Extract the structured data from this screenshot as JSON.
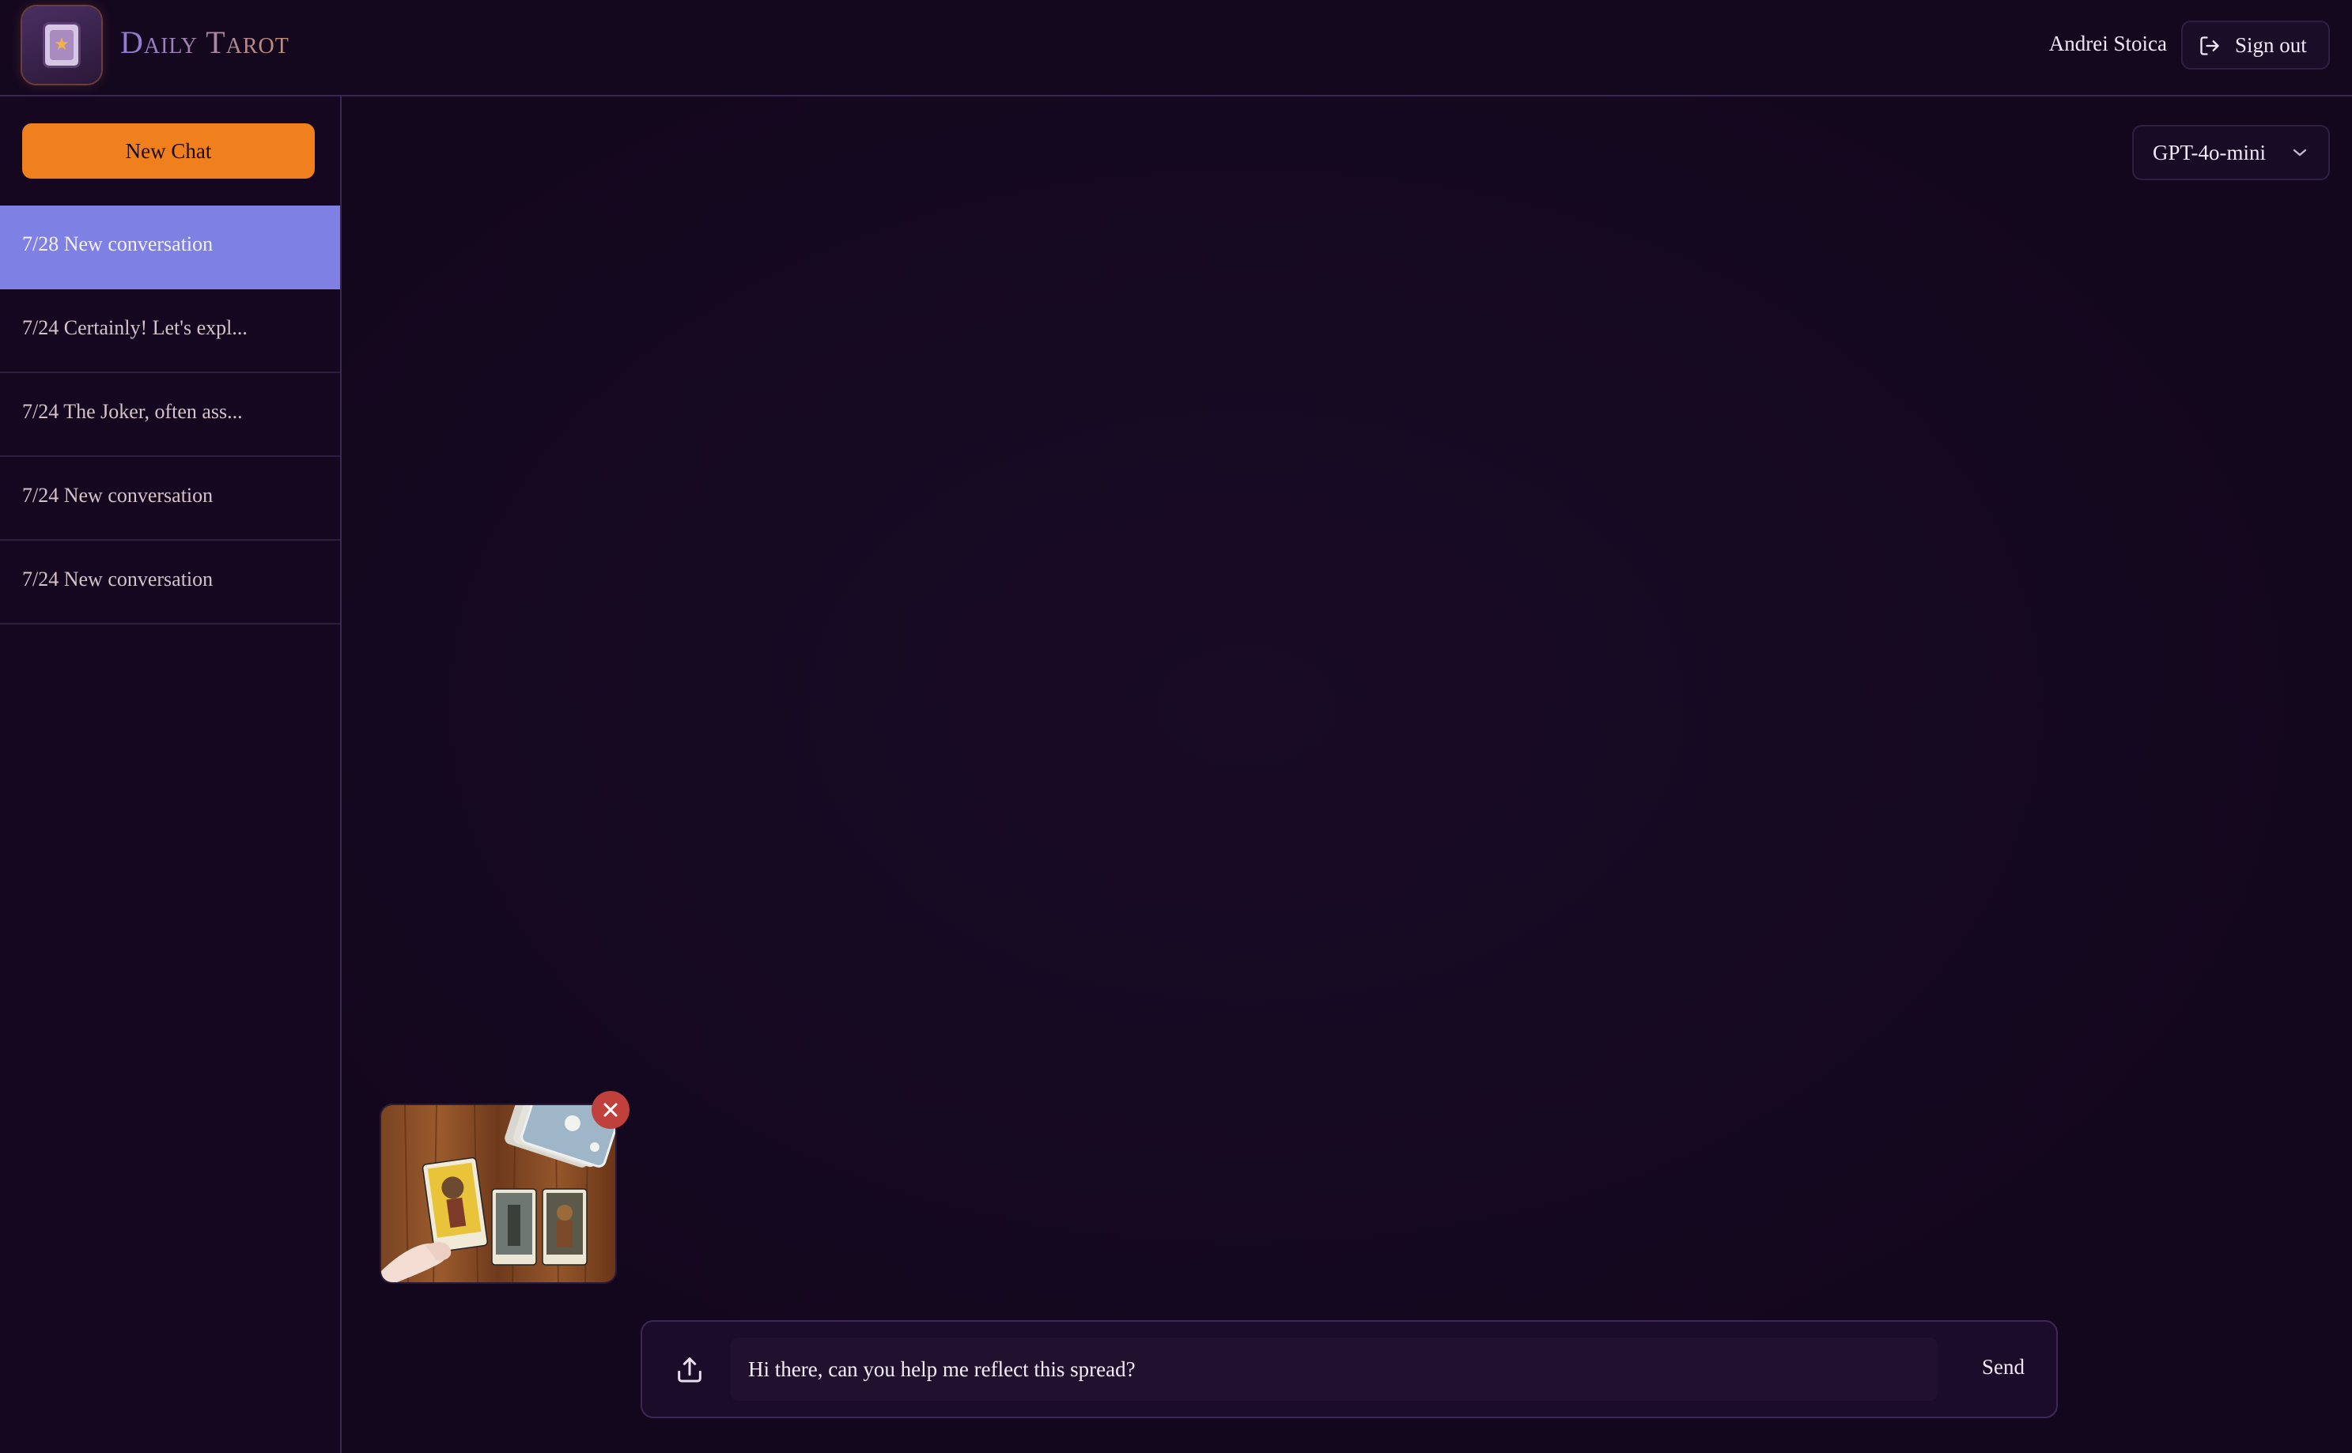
{
  "app": {
    "brand": "Daily Tarot",
    "logo_icon": "tarot-card-star-icon"
  },
  "header": {
    "user_name": "Andrei Stoica",
    "signout_label": "Sign out",
    "signout_icon": "sign-out-icon"
  },
  "sidebar": {
    "new_chat_label": "New Chat",
    "conversations": [
      {
        "label": "7/28 New conversation",
        "active": true
      },
      {
        "label": "7/24 Certainly! Let's expl...",
        "active": false
      },
      {
        "label": "7/24 The Joker, often ass...",
        "active": false
      },
      {
        "label": "7/24 New conversation",
        "active": false
      },
      {
        "label": "7/24 New conversation",
        "active": false
      }
    ]
  },
  "main": {
    "model_selected": "GPT-4o-mini",
    "attachment": {
      "image_icon": "tarot-spread-photo",
      "remove_icon": "close-icon"
    },
    "composer": {
      "input_value": "Hi there, can you help me reflect this spread?",
      "send_label": "Send",
      "upload_icon": "upload-icon"
    }
  },
  "colors": {
    "background": "#13071e",
    "accent_orange": "#f07f1e",
    "active_item": "#7f80e3",
    "remove_red": "#c0403c",
    "border": "#3b2552"
  }
}
